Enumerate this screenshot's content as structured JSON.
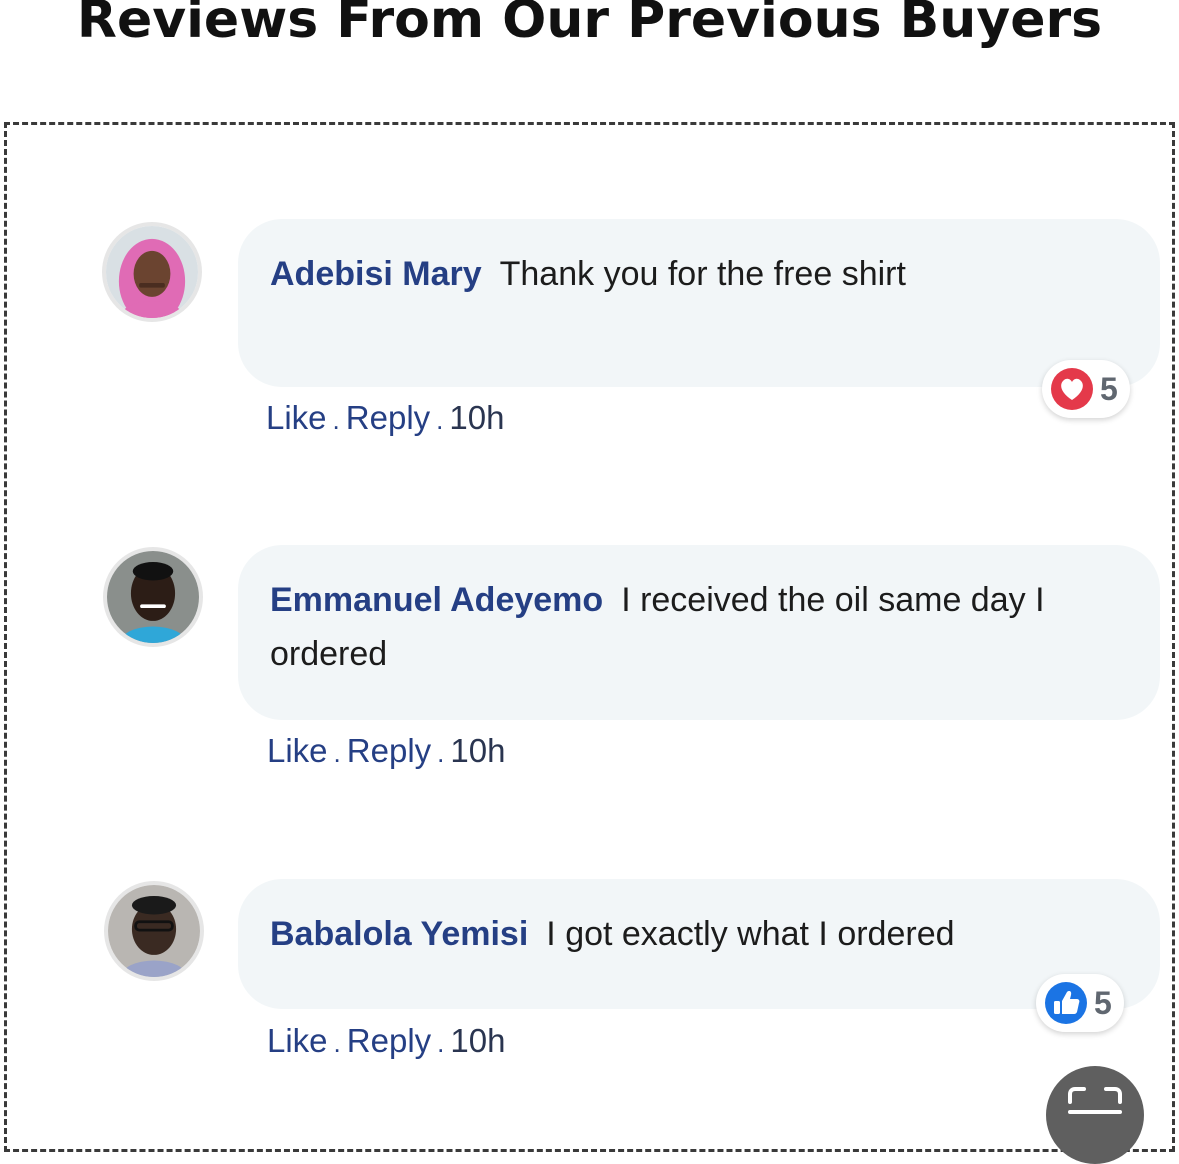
{
  "heading": "Reviews From Our Previous Buyers",
  "comments": [
    {
      "name": "Adebisi Mary",
      "text": "Thank you for the free shirt",
      "like_label": "Like",
      "reply_label": "Reply",
      "time": "10h",
      "reaction": {
        "icon": "heart-icon",
        "count": "5",
        "color": "#e4394a"
      }
    },
    {
      "name": "Emmanuel Adeyemo",
      "text": "I received the oil same day I ordered",
      "like_label": "Like",
      "reply_label": "Reply",
      "time": "10h"
    },
    {
      "name": "Babalola Yemisi",
      "text": "I got exactly what I ordered",
      "like_label": "Like",
      "reply_label": "Reply",
      "time": "10h",
      "reaction": {
        "icon": "thumbs-up-icon",
        "count": "5",
        "color": "#1b74e4"
      }
    }
  ],
  "separator": ".",
  "colors": {
    "name": "#253f84",
    "bubble": "#f2f6f8",
    "heart": "#e4394a",
    "like": "#1b74e4"
  },
  "floating_button_icon": "scan-icon"
}
